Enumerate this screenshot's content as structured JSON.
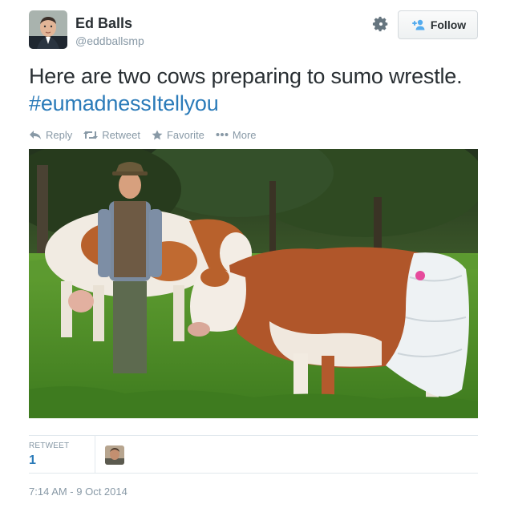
{
  "user": {
    "name": "Ed Balls",
    "handle": "@eddballsmp"
  },
  "follow_button": {
    "label": "Follow"
  },
  "tweet": {
    "text": "Here are two cows preparing to sumo wrestle.",
    "hashtag": "#eumadnessItellyou"
  },
  "actions": {
    "reply": "Reply",
    "retweet": "Retweet",
    "favorite": "Favorite",
    "more": "More"
  },
  "stats": {
    "retweet_label": "RETWEET",
    "retweet_count": "1"
  },
  "timestamp": "7:14 AM - 9 Oct 2014",
  "colors": {
    "hashtag": "#2b7bb9",
    "muted": "#8899a6",
    "text": "#292f33"
  },
  "icons": [
    "gear-icon",
    "follow-user-icon",
    "reply-icon",
    "retweet-icon",
    "favorite-icon",
    "more-icon"
  ]
}
